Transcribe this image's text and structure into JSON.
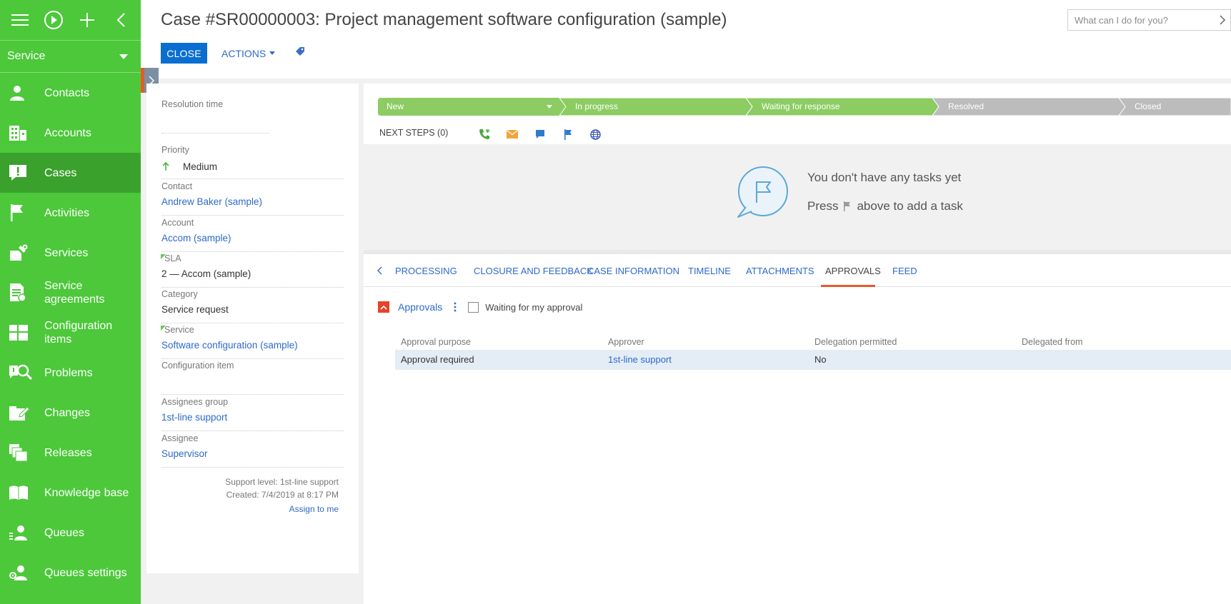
{
  "sidebar": {
    "workspace": "Service",
    "items": [
      {
        "label": "Contacts",
        "icon": "person-icon"
      },
      {
        "label": "Accounts",
        "icon": "building-icon"
      },
      {
        "label": "Cases",
        "icon": "case-alert-icon"
      },
      {
        "label": "Activities",
        "icon": "flag-icon"
      },
      {
        "label": "Services",
        "icon": "services-wrench-icon"
      },
      {
        "label": "Service agreements",
        "icon": "agreement-icon"
      },
      {
        "label": "Configuration items",
        "icon": "config-items-icon"
      },
      {
        "label": "Problems",
        "icon": "problem-magnifier-icon"
      },
      {
        "label": "Changes",
        "icon": "changes-icon"
      },
      {
        "label": "Releases",
        "icon": "releases-icon"
      },
      {
        "label": "Knowledge base",
        "icon": "book-icon"
      },
      {
        "label": "Queues",
        "icon": "queue-person-icon"
      },
      {
        "label": "Queues settings",
        "icon": "queue-settings-icon"
      }
    ]
  },
  "header": {
    "title": "Case #SR00000003: Project management software configuration (sample)",
    "close_label": "CLOSE",
    "actions_label": "ACTIONS",
    "search_placeholder": "What can I do for you?"
  },
  "left_panel": {
    "resolution_time_label": "Resolution time",
    "resolution_time_value": "",
    "priority_label": "Priority",
    "priority_value": "Medium",
    "contact_label": "Contact",
    "contact_value": "Andrew Baker (sample)",
    "account_label": "Account",
    "account_value": "Accom (sample)",
    "sla_label": "SLA",
    "sla_value": "2 — Accom (sample)",
    "category_label": "Category",
    "category_value": "Service request",
    "service_label": "Service",
    "service_value": "Software configuration (sample)",
    "config_item_label": "Configuration item",
    "config_item_value": "",
    "assignees_group_label": "Assignees group",
    "assignees_group_value": "1st-line support",
    "assignee_label": "Assignee",
    "assignee_value": "Supervisor",
    "assign_to_me": "Assign to me",
    "support_level": "Support level: 1st-line support",
    "created": "Created: 7/4/2019 at 8:17 PM"
  },
  "stages": [
    {
      "label": "New",
      "state": "done"
    },
    {
      "label": "In progress",
      "state": "done"
    },
    {
      "label": "Waiting for response",
      "state": "done"
    },
    {
      "label": "Resolved",
      "state": "pending"
    },
    {
      "label": "Closed",
      "state": "pending"
    }
  ],
  "colors": {
    "sidebar": "#4cc83a",
    "sidebar_active": "#3aa12c",
    "stage_done": "#8ccc62",
    "stage_pending": "#bcbcbc",
    "primary_button": "#0a6ed1",
    "link": "#2e6ac9",
    "accent": "#e55a2b"
  },
  "next_steps": {
    "label": "NEXT STEPS (0)",
    "icons": [
      "call-icon",
      "email-icon",
      "chat-icon",
      "flag-icon",
      "globe-icon"
    ]
  },
  "tasks_empty": {
    "line1": "You don't have any tasks yet",
    "line2_before": "Press",
    "line2_after": "above to add a task"
  },
  "tabs": {
    "items": [
      "PROCESSING",
      "CLOSURE AND FEEDBACK",
      "CASE INFORMATION",
      "TIMELINE",
      "ATTACHMENTS",
      "APPROVALS",
      "FEED"
    ],
    "active": "APPROVALS"
  },
  "approvals": {
    "title": "Approvals",
    "checkbox_label": "Waiting for my approval",
    "checkbox_checked": false,
    "columns": [
      "Approval purpose",
      "Approver",
      "Delegation permitted",
      "Delegated from"
    ],
    "rows": [
      {
        "purpose": "Approval required",
        "approver": "1st-line support",
        "delegation": "No",
        "delegated_from": ""
      }
    ]
  }
}
